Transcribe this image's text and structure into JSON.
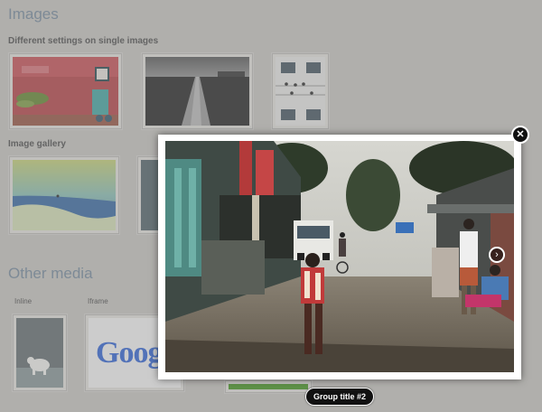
{
  "headings": {
    "images": "Images",
    "single_images": "Different settings on single images",
    "gallery": "Image gallery",
    "other_media": "Other media"
  },
  "media_labels": {
    "inline": "Inline",
    "iframe": "Iframe"
  },
  "iframe_preview_text": "Goog",
  "lightbox": {
    "close_glyph": "✕",
    "next_glyph": "›",
    "title": "Group title #2"
  }
}
